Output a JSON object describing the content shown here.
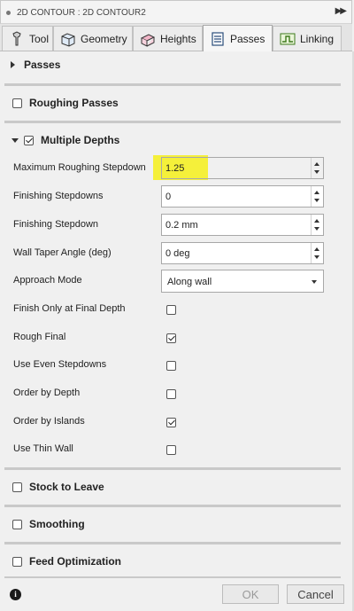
{
  "window": {
    "title": "2D CONTOUR : 2D CONTOUR2",
    "expand_icon": "double-chevron-right-icon"
  },
  "tabs": [
    {
      "label": "Tool",
      "icon": "tool-icon",
      "active": false
    },
    {
      "label": "Geometry",
      "icon": "geometry-icon",
      "active": false
    },
    {
      "label": "Heights",
      "icon": "heights-icon",
      "active": false
    },
    {
      "label": "Passes",
      "icon": "passes-icon",
      "active": true
    },
    {
      "label": "Linking",
      "icon": "linking-icon",
      "active": false
    }
  ],
  "sections": {
    "passes": {
      "label": "Passes",
      "expanded": false
    },
    "roughing_passes": {
      "label": "Roughing Passes",
      "checked": false
    },
    "multiple_depths": {
      "label": "Multiple Depths",
      "checked": true,
      "expanded": true
    },
    "stock_to_leave": {
      "label": "Stock to Leave",
      "checked": false
    },
    "smoothing": {
      "label": "Smoothing",
      "checked": false
    },
    "feed_optimization": {
      "label": "Feed Optimization",
      "checked": false
    }
  },
  "fields": {
    "max_roughing_stepdown": {
      "label": "Maximum Roughing Stepdown",
      "value": "1.25",
      "highlight": "#f5f03a"
    },
    "finishing_stepdowns": {
      "label": "Finishing Stepdowns",
      "value": "0"
    },
    "finishing_stepdown": {
      "label": "Finishing Stepdown",
      "value": "0.2 mm"
    },
    "wall_taper_angle": {
      "label": "Wall Taper Angle (deg)",
      "value": "0 deg"
    },
    "approach_mode": {
      "label": "Approach Mode",
      "value": "Along wall"
    }
  },
  "checks": [
    {
      "key": "finish_only_final",
      "label": "Finish Only at Final Depth",
      "checked": false
    },
    {
      "key": "rough_final",
      "label": "Rough Final",
      "checked": true
    },
    {
      "key": "use_even_stepdowns",
      "label": "Use Even Stepdowns",
      "checked": false
    },
    {
      "key": "order_by_depth",
      "label": "Order by Depth",
      "checked": false
    },
    {
      "key": "order_by_islands",
      "label": "Order by Islands",
      "checked": true
    },
    {
      "key": "use_thin_wall",
      "label": "Use Thin Wall",
      "checked": false
    }
  ],
  "footer": {
    "info_icon": "info-icon",
    "ok_label": "OK",
    "cancel_label": "Cancel"
  },
  "colors": {
    "background": "#f0f0f0",
    "highlight": "#f5f03a",
    "separator": "#c9c9c9"
  }
}
